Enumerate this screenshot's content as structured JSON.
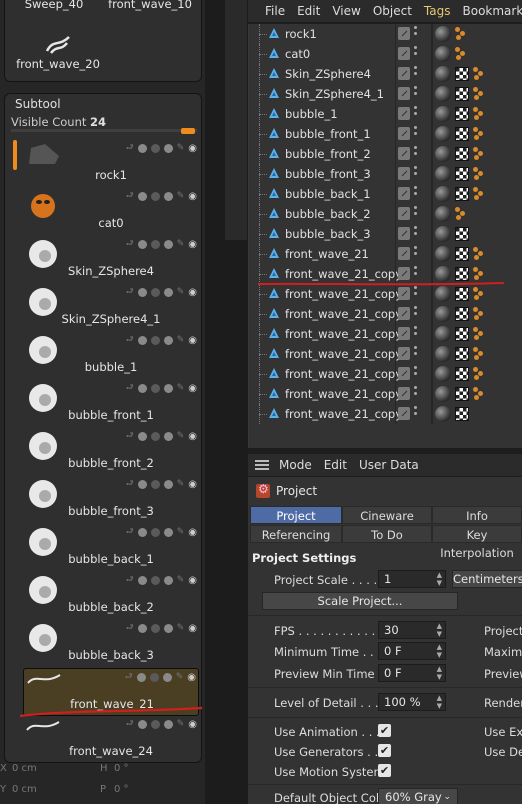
{
  "brushes": {
    "items": [
      {
        "label": "Sweep_40"
      },
      {
        "label": "front_wave_10"
      },
      {
        "label": "front_wave_20"
      }
    ]
  },
  "subtool": {
    "title": "Subtool",
    "visible_count_label": "Visible Count",
    "visible_count_value": "24",
    "items": [
      {
        "label": "rock1"
      },
      {
        "label": "cat0"
      },
      {
        "label": "Skin_ZSphere4"
      },
      {
        "label": "Skin_ZSphere4_1"
      },
      {
        "label": "bubble_1"
      },
      {
        "label": "bubble_front_1"
      },
      {
        "label": "bubble_front_2"
      },
      {
        "label": "bubble_front_3"
      },
      {
        "label": "bubble_back_1"
      },
      {
        "label": "bubble_back_2"
      },
      {
        "label": "bubble_back_3"
      },
      {
        "label": "front_wave_21",
        "selected": true
      },
      {
        "label": "front_wave_24"
      }
    ]
  },
  "left_bottom": {
    "x_label": "X",
    "x_value": "0 cm",
    "h_label": "H",
    "h_value": "0 °",
    "y_label": "Y",
    "y_value": "0 cm",
    "p_label": "P",
    "p_value": "0 °"
  },
  "object_manager": {
    "menu": [
      "File",
      "Edit",
      "View",
      "Object",
      "Tags",
      "Bookmarks"
    ],
    "highlight_menu": "Tags",
    "objects": [
      {
        "name": "rock1",
        "tags": "s-o"
      },
      {
        "name": "cat0",
        "tags": "s-o"
      },
      {
        "name": "Skin_ZSphere4",
        "tags": "s-c-o"
      },
      {
        "name": "Skin_ZSphere4_1",
        "tags": "s-c-o"
      },
      {
        "name": "bubble_1",
        "tags": "s-c-o"
      },
      {
        "name": "bubble_front_1",
        "tags": "s-c-o"
      },
      {
        "name": "bubble_front_2",
        "tags": "s-c-o"
      },
      {
        "name": "bubble_front_3",
        "tags": "s-c-o"
      },
      {
        "name": "bubble_back_1",
        "tags": "s-c-o"
      },
      {
        "name": "bubble_back_2",
        "tags": "s-o"
      },
      {
        "name": "bubble_back_3",
        "tags": "s-c"
      },
      {
        "name": "front_wave_21",
        "tags": "s-c-o"
      },
      {
        "name": "front_wave_21_copy1",
        "tags": "s-c-o"
      },
      {
        "name": "front_wave_21_copy2",
        "tags": "s-c-o"
      },
      {
        "name": "front_wave_21_copy3",
        "tags": "s-c-o"
      },
      {
        "name": "front_wave_21_copy4",
        "tags": "s-c-o"
      },
      {
        "name": "front_wave_21_copy5",
        "tags": "s-c-o"
      },
      {
        "name": "front_wave_21_copy6",
        "tags": "s-c-o"
      },
      {
        "name": "front_wave_21_copy7",
        "tags": "s-c-o"
      },
      {
        "name": "front_wave_21_copy8",
        "tags": "s-c"
      }
    ]
  },
  "attribute_manager": {
    "menu": [
      "Mode",
      "Edit",
      "User Data"
    ],
    "object_title": "Project",
    "tabs_row1": [
      "Project Settings",
      "Cineware",
      "Info"
    ],
    "tabs_row2": [
      "Referencing",
      "To Do",
      "Key Interpolation"
    ],
    "active_tab": "Project Settings",
    "section_title": "Project Settings",
    "project_scale_label": "Project Scale . . . . .",
    "project_scale_value": "1",
    "project_scale_unit": "Centimeters",
    "scale_project_button": "Scale Project...",
    "fps_label": "FPS . . . . . . . . . . . .",
    "fps_value": "30",
    "project_time_label": "Project T",
    "min_time_label": "Minimum Time . . . .",
    "min_time_value": "0 F",
    "max_time_label": "Maximu",
    "preview_min_label": "Preview Min Time . .",
    "preview_min_value": "0 F",
    "preview_max_label": "Preview",
    "lod_label": "Level of Detail . . . .",
    "lod_value": "100 %",
    "render_label": "Render",
    "use_animation_label": "Use Animation . . . .",
    "use_generators_label": "Use Generators . . .",
    "use_motion_label": "Use Motion System",
    "use_exp_label": "Use Exp",
    "use_def_label": "Use Def",
    "check": "✔",
    "default_color_label": "Default Object Color",
    "default_color_value": "60% Gray"
  }
}
